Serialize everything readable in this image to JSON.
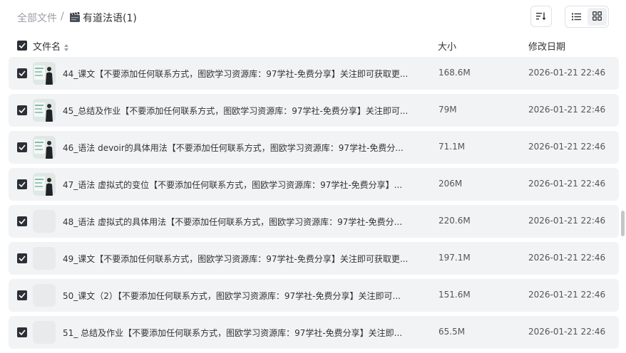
{
  "breadcrumb": {
    "root": "全部文件",
    "separator": "/",
    "current": "有道法语(1)",
    "current_icon": "clapperboard-icon"
  },
  "toolbar": {
    "sort_icon": "sort-lines-icon",
    "list_view_icon": "list-icon",
    "grid_view_icon": "grid-icon",
    "active_view": "grid"
  },
  "columns": {
    "name": "文件名",
    "size": "大小",
    "date": "修改日期"
  },
  "files": [
    {
      "name": "44_课文【不要添加任何联系方式，图欧学习资源库：97学社-免费分享】关注即可获取更...",
      "size": "168.6M",
      "date": "2026-01-21 22:46",
      "has_thumb": true,
      "checked": true
    },
    {
      "name": "45_总结及作业【不要添加任何联系方式，图欧学习资源库：97学社-免费分享】关注即可...",
      "size": "79M",
      "date": "2026-01-21 22:46",
      "has_thumb": true,
      "checked": true
    },
    {
      "name": "46_语法 devoir的具体用法【不要添加任何联系方式，图欧学习资源库：97学社-免费分...",
      "size": "71.1M",
      "date": "2026-01-21 22:46",
      "has_thumb": true,
      "checked": true
    },
    {
      "name": "47_语法 虚拟式的变位【不要添加任何联系方式，图欧学习资源库：97学社-免费分享】...",
      "size": "206M",
      "date": "2026-01-21 22:46",
      "has_thumb": true,
      "checked": true
    },
    {
      "name": "48_语法 虚拟式的具体用法【不要添加任何联系方式，图欧学习资源库：97学社-免费分...",
      "size": "220.6M",
      "date": "2026-01-21 22:46",
      "has_thumb": false,
      "checked": true
    },
    {
      "name": "49_课文【不要添加任何联系方式，图欧学习资源库：97学社-免费分享】关注即可获取更...",
      "size": "197.1M",
      "date": "2026-01-21 22:46",
      "has_thumb": false,
      "checked": true
    },
    {
      "name": "50_课文（2）【不要添加任何联系方式，图欧学习资源库：97学社-免费分享】关注即可...",
      "size": "151.6M",
      "date": "2026-01-21 22:46",
      "has_thumb": false,
      "checked": true
    },
    {
      "name": "51_ 总结及作业【不要添加任何联系方式，图欧学习资源库：97学社-免费分享】关注即...",
      "size": "65.5M",
      "date": "2026-01-21 22:46",
      "has_thumb": false,
      "checked": true
    }
  ]
}
